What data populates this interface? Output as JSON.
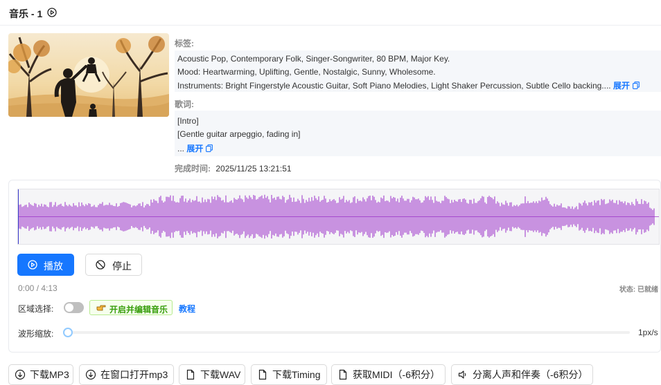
{
  "header": {
    "title": "音乐 - 1"
  },
  "tags": {
    "label": "标签:",
    "lines": [
      "Acoustic Pop, Contemporary Folk, Singer-Songwriter, 80 BPM, Major Key.",
      "Mood: Heartwarming, Uplifting, Gentle, Nostalgic, Sunny, Wholesome.",
      "Instruments: Bright Fingerstyle Acoustic Guitar, Soft Piano Melodies, Light Shaker Percussion, Subtle Cello backing...."
    ],
    "expand": "展开"
  },
  "lyrics": {
    "label": "歌词:",
    "lines": [
      "[Intro]",
      "[Gentle guitar arpeggio, fading in]"
    ],
    "ellipsis": "...",
    "expand": "展开"
  },
  "completed": {
    "label": "完成时间:",
    "value": "2025/11/25 13:21:51"
  },
  "player": {
    "play_label": "播放",
    "stop_label": "停止",
    "timecode": "0:00 / 4:13",
    "status": "状态: 已就绪",
    "region_label": "区域选择:",
    "region_enabled": false,
    "edit_tag": "开启并编辑音乐",
    "tutorial": "教程",
    "zoom_label": "波形缩放:",
    "zoom_value": "1px/s",
    "zoom_level": 0,
    "waveform_color": "#9b30c8",
    "progress": 0
  },
  "downloads": [
    {
      "label": "下载MP3",
      "icon": "download-icon"
    },
    {
      "label": "在窗口打开mp3",
      "icon": "download-icon"
    },
    {
      "label": "下载WAV",
      "icon": "file-icon"
    },
    {
      "label": "下载Timing",
      "icon": "file-icon"
    },
    {
      "label": "获取MIDI（-6积分）",
      "icon": "file-icon"
    },
    {
      "label": "分离人声和伴奏（-6积分）",
      "icon": "sound-icon"
    }
  ],
  "colors": {
    "accent": "#1677ff",
    "success": "#389e0d",
    "waveform": "#9b30c8"
  }
}
